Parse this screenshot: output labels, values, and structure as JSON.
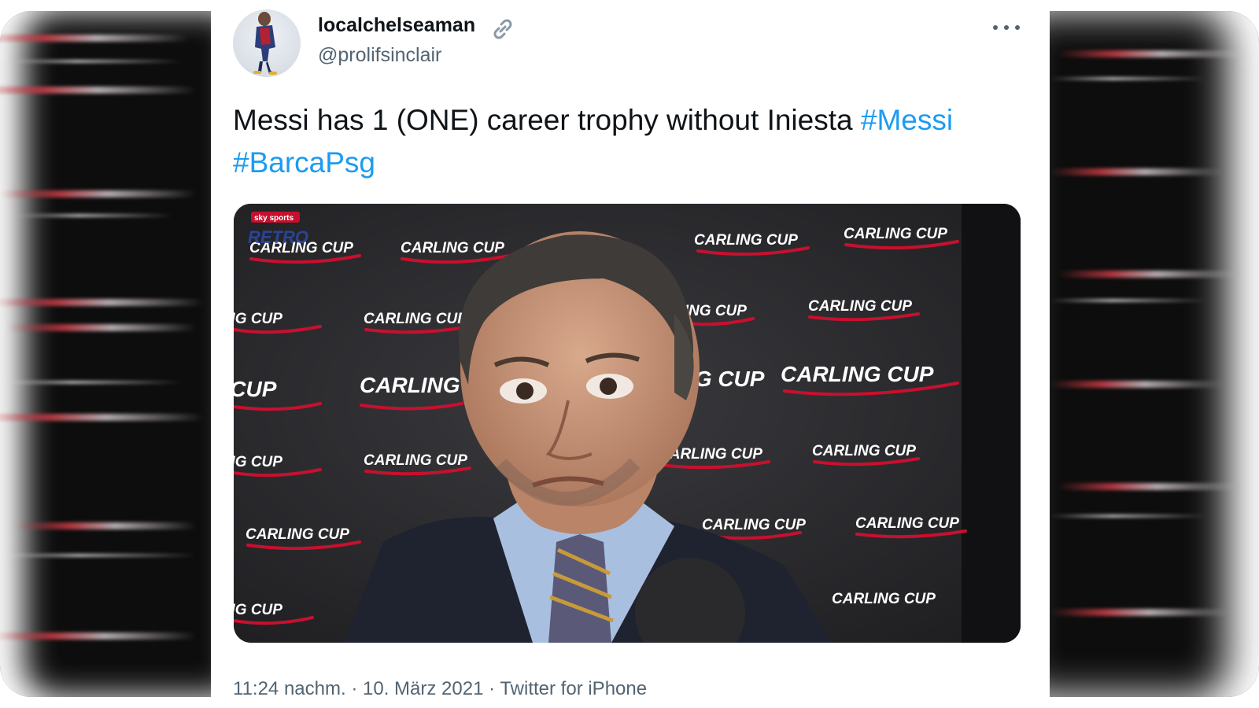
{
  "tweet": {
    "display_name": "localchelseaman",
    "handle": "@prolifsinclair",
    "text": "Messi has 1 (ONE) career trophy without Iniesta",
    "hashtags": [
      "#Messi",
      "#BarcaPsg"
    ],
    "timestamp": "11:24 nachm.",
    "date": "10. März 2021",
    "source": "Twitter for iPhone",
    "separator": "·"
  },
  "media": {
    "broadcaster_logo": "sky sports",
    "overlay_tag": "RETRO",
    "backdrop_sponsor": "CARLING CUP"
  },
  "icons": {
    "link": "link-icon",
    "more": "more-options-icon"
  },
  "colors": {
    "text": "#0f1419",
    "muted": "#536471",
    "hashtag": "#1d9bf0",
    "backdrop_red": "#c8102e"
  }
}
